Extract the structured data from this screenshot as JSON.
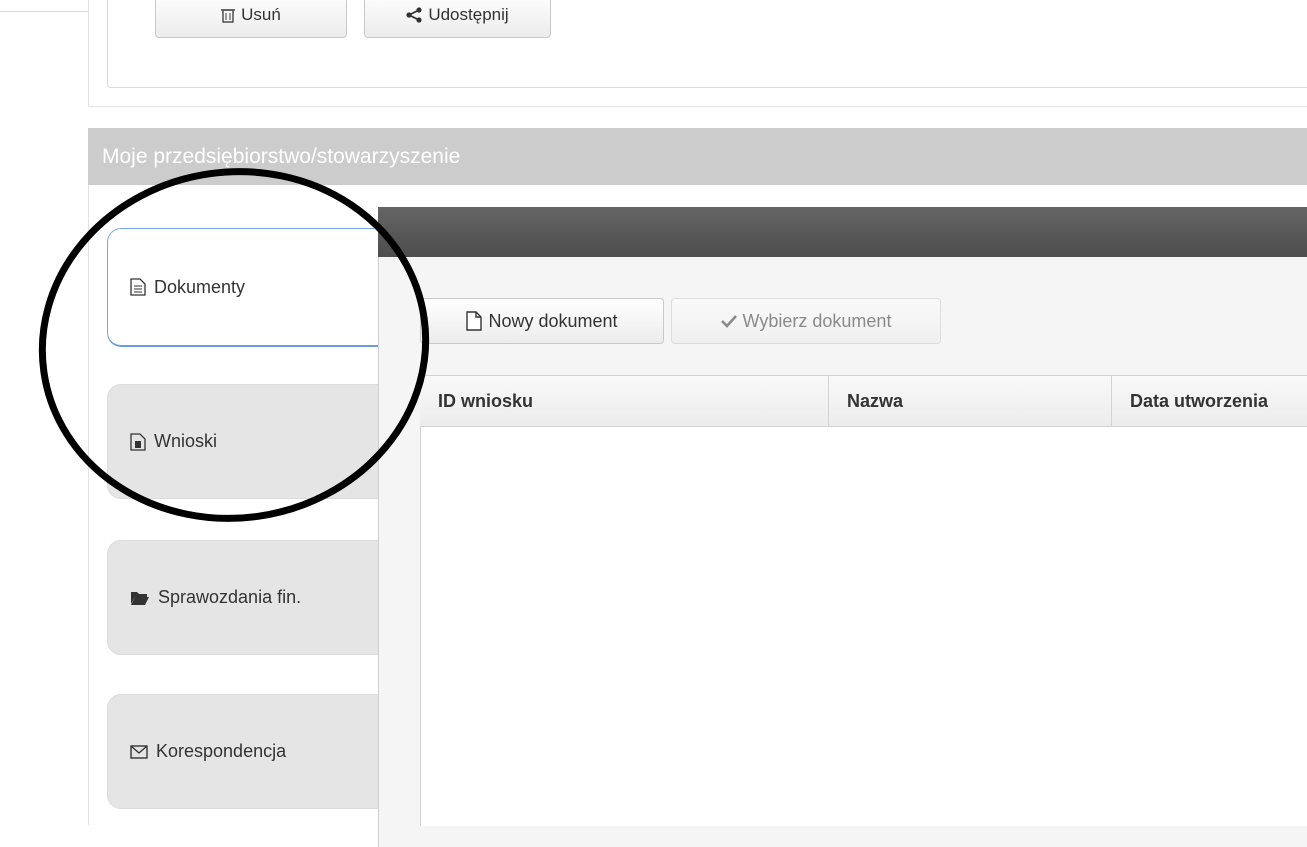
{
  "top_actions": {
    "delete_label": "Usuń",
    "share_label": "Udostępnij"
  },
  "section": {
    "title": "Moje przedsiębiorstwo/stowarzyszenie"
  },
  "tabs": [
    {
      "label": "Dokumenty",
      "icon": "document-icon",
      "active": true
    },
    {
      "label": "Wnioski",
      "icon": "application-icon",
      "active": false
    },
    {
      "label": "Sprawozdania fin.",
      "icon": "folder-open-icon",
      "active": false
    },
    {
      "label": "Korespondencja",
      "icon": "envelope-icon",
      "active": false
    }
  ],
  "toolbar": {
    "new_document_label": "Nowy dokument",
    "choose_document_label": "Wybierz dokument"
  },
  "table": {
    "columns": [
      "ID wniosku",
      "Nazwa",
      "Data utworzenia"
    ],
    "rows": []
  },
  "colors": {
    "section_header": "#cccccc",
    "dark_bar": "#555555",
    "active_tab_border": "#6d9be0",
    "annotation": "#000000"
  }
}
